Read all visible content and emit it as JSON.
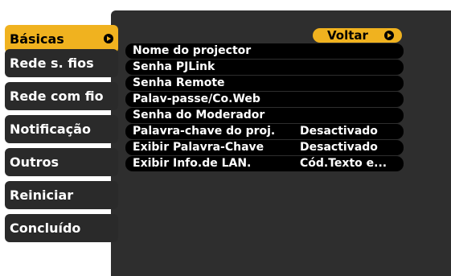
{
  "sidebar": {
    "items": [
      {
        "label": "Básicas",
        "active": true
      },
      {
        "label": "Rede s. fios"
      },
      {
        "label": "Rede com fio"
      },
      {
        "label": "Notificação"
      },
      {
        "label": "Outros"
      },
      {
        "label": "Reiniciar"
      },
      {
        "label": "Concluído"
      }
    ]
  },
  "header": {
    "back_label": "Voltar"
  },
  "menu": {
    "items": [
      {
        "label": "Nome do projector",
        "value": ""
      },
      {
        "label": "Senha PJLink",
        "value": ""
      },
      {
        "label": "Senha Remote",
        "value": ""
      },
      {
        "label": "Palav-passe/Co.Web",
        "value": ""
      },
      {
        "label": "Senha do Moderador",
        "value": ""
      },
      {
        "label": "Palavra-chave do proj.",
        "value": "Desactivado"
      },
      {
        "label": "Exibir Palavra-Chave",
        "value": "Desactivado"
      },
      {
        "label": "Exibir Info.de LAN.",
        "value": "Cód.Texto e..."
      }
    ]
  },
  "colors": {
    "accent": "#f0b21f",
    "panel": "#2e2e2e",
    "row": "#000000"
  }
}
